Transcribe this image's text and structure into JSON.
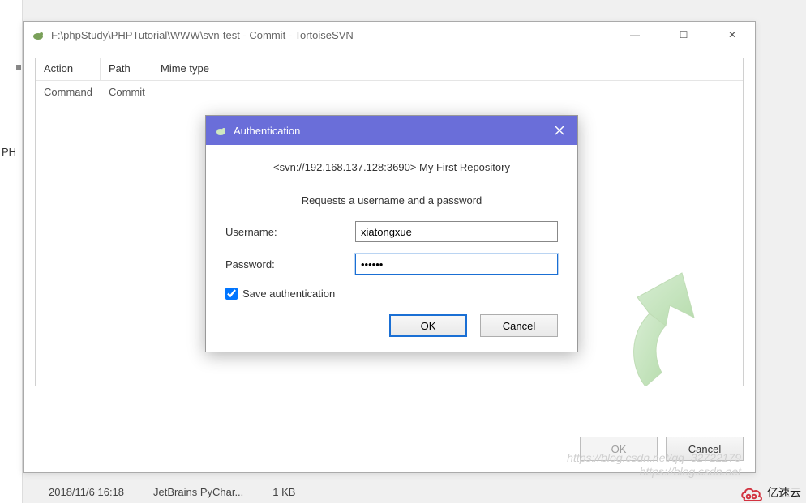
{
  "background": {
    "ph_label": "PH"
  },
  "window": {
    "title": "F:\\phpStudy\\PHPTutorial\\WWW\\svn-test - Commit - TortoiseSVN",
    "min": "—",
    "max": "☐",
    "close": "✕",
    "ok": "OK",
    "cancel": "Cancel"
  },
  "grid": {
    "headers": {
      "action": "Action",
      "path": "Path",
      "mime": "Mime type"
    },
    "row1": {
      "action": "Command",
      "path": "Commit"
    }
  },
  "auth": {
    "title": "Authentication",
    "url": "<svn://192.168.137.128:3690> My First Repository",
    "prompt": "Requests a username and a password",
    "username_label": "Username:",
    "username_value": "xiatongxue",
    "password_label": "Password:",
    "password_value": "••••••",
    "save_label": "Save authentication",
    "ok": "OK",
    "cancel": "Cancel"
  },
  "filebar": {
    "date": "2018/11/6 16:18",
    "app": "JetBrains PyChar...",
    "size": "1 KB"
  },
  "watermark": {
    "line1": "https://blog.csdn.net/qq_32722179",
    "line2": "https://blog.csdn.net"
  },
  "brand": {
    "text": "亿速云"
  }
}
